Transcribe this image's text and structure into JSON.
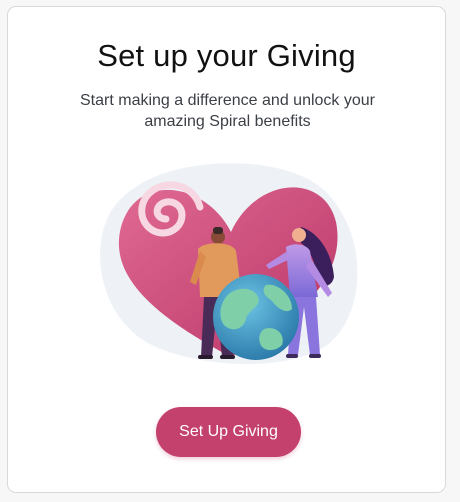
{
  "onboarding": {
    "title": "Set up your Giving",
    "subtitle": "Start making a difference and unlock your amazing Spiral benefits",
    "illustration_icon": "heart-globe-people-illustration",
    "cta_label": "Set Up Giving",
    "colors": {
      "accent": "#c4406d",
      "heart": "#d04f7c",
      "globe_water": "#3fa0c8",
      "globe_land": "#74c4a3"
    }
  }
}
